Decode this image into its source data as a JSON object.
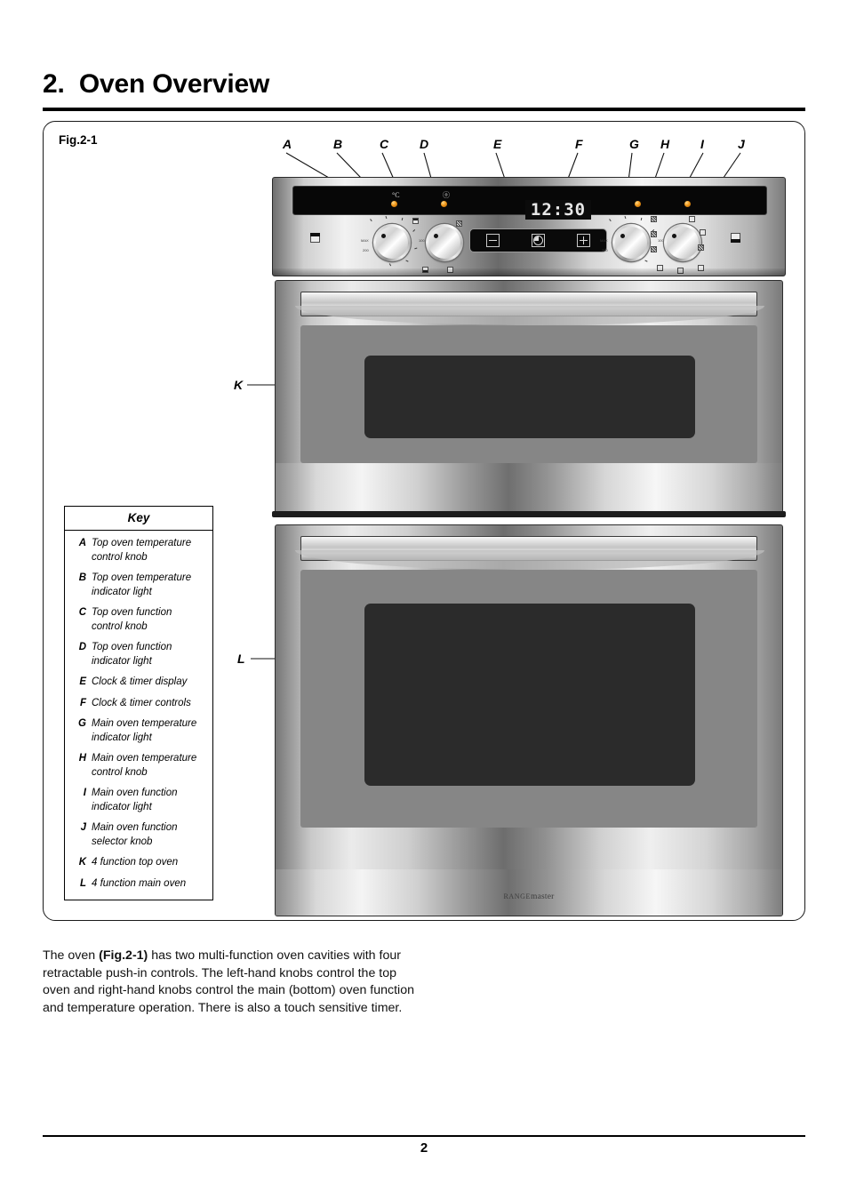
{
  "document": {
    "chapter_number": "2.",
    "chapter_title": "Oven Overview",
    "page_number": "2"
  },
  "figure": {
    "label": "Fig.2-1",
    "callout_letters": [
      "A",
      "B",
      "C",
      "D",
      "E",
      "F",
      "G",
      "H",
      "I",
      "J"
    ],
    "callout_left": [
      "K",
      "L"
    ],
    "brand_prefix": "RANGE",
    "brand_suffix": "master"
  },
  "control_panel": {
    "timer_display_value": "12:30",
    "timer_buttons": [
      {
        "name": "minus",
        "symbol": "−"
      },
      {
        "name": "clock",
        "symbol": "◔"
      },
      {
        "name": "plus",
        "symbol": "+"
      }
    ],
    "top_temp_symbol": "°C",
    "top_function_symbol": "ⓞ",
    "knobs": [
      "top-oven-temperature-knob",
      "top-oven-function-knob",
      "main-oven-temperature-knob",
      "main-oven-function-knob"
    ]
  },
  "key": {
    "heading": "Key",
    "items": [
      {
        "letter": "A",
        "text": "Top oven temperature\ncontrol knob"
      },
      {
        "letter": "B",
        "text": "Top oven temperature\nindicator light"
      },
      {
        "letter": "C",
        "text": "Top oven function\ncontrol knob"
      },
      {
        "letter": "D",
        "text": "Top oven function\nindicator light"
      },
      {
        "letter": "E",
        "text": "Clock & timer display"
      },
      {
        "letter": "F",
        "text": "Clock & timer controls"
      },
      {
        "letter": "G",
        "text": "Main oven temperature\nindicator light"
      },
      {
        "letter": "H",
        "text": "Main oven temperature\ncontrol knob"
      },
      {
        "letter": "I",
        "text": "Main oven function\nindicator light"
      },
      {
        "letter": "J",
        "text": "Main oven function\nselector knob"
      },
      {
        "letter": "K",
        "text": "4 function top oven"
      },
      {
        "letter": "L",
        "text": "4 function main oven"
      }
    ]
  },
  "body": {
    "paragraph_part1": "The oven ",
    "paragraph_bold": "(Fig.2-1)",
    "paragraph_part2": " has two multi-function oven cavities with four retractable push-in controls. The left-hand knobs control the top oven and right-hand knobs control the main (bottom) oven function and temperature operation. There is also a touch sensitive timer."
  },
  "colors": {
    "indicator_light": "#f0981a",
    "panel_black": "#070707",
    "glass": "#2b2b2b",
    "rule": "#000000"
  }
}
